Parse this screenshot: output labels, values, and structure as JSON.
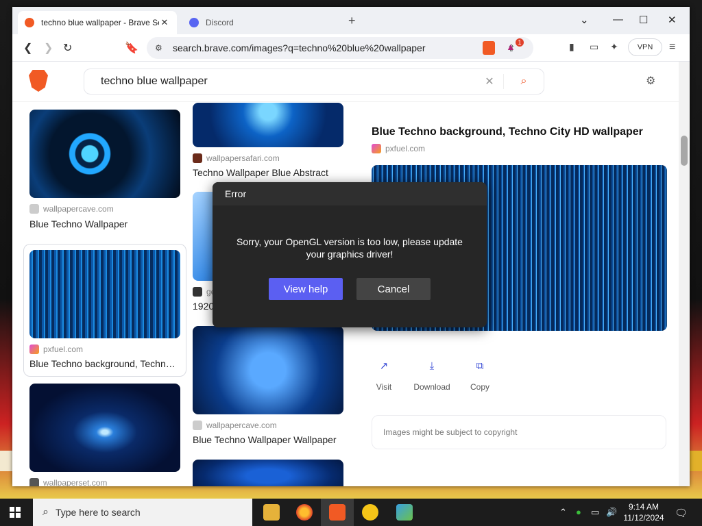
{
  "browser": {
    "tabs": [
      {
        "label": "techno blue wallpaper - Brave Search",
        "active": true
      },
      {
        "label": "Discord",
        "active": false
      }
    ],
    "url": "search.brave.com/images?q=techno%20blue%20wallpaper",
    "notification_badge": "1",
    "vpn_label": "VPN"
  },
  "search": {
    "query": "techno blue wallpaper"
  },
  "results": {
    "col1": [
      {
        "source": "wallpapercave.com",
        "caption": "Blue Techno Wallpaper"
      },
      {
        "source": "pxfuel.com",
        "caption": "Blue Techno background, Techno City HD wallpaper"
      },
      {
        "source": "wallpaperset.com",
        "caption": ""
      }
    ],
    "col2": [
      {
        "source": "wallpapersafari.com",
        "caption": "Techno Wallpaper Blue Abstract"
      },
      {
        "source": "ge",
        "caption": "1920"
      },
      {
        "source": "wallpapercave.com",
        "caption": "Blue Techno Wallpaper Wallpaper"
      }
    ]
  },
  "detail": {
    "title": "Blue Techno background, Techno City HD wallpaper",
    "source": "pxfuel.com",
    "actions": {
      "visit": "Visit",
      "download": "Download",
      "copy": "Copy"
    },
    "copyright_note": "Images might be subject to copyright"
  },
  "dialog": {
    "title": "Error",
    "message": "Sorry, your OpenGL version is too low, please update your graphics driver!",
    "ok_label": "View help",
    "cancel_label": "Cancel"
  },
  "taskbar": {
    "search_placeholder": "Type here to search",
    "time": "9:14 AM",
    "date": "11/12/2024"
  },
  "colors": {
    "accent": "#5b5ff2",
    "brave_orange": "#f15a24",
    "dialog_bg": "#262626"
  }
}
